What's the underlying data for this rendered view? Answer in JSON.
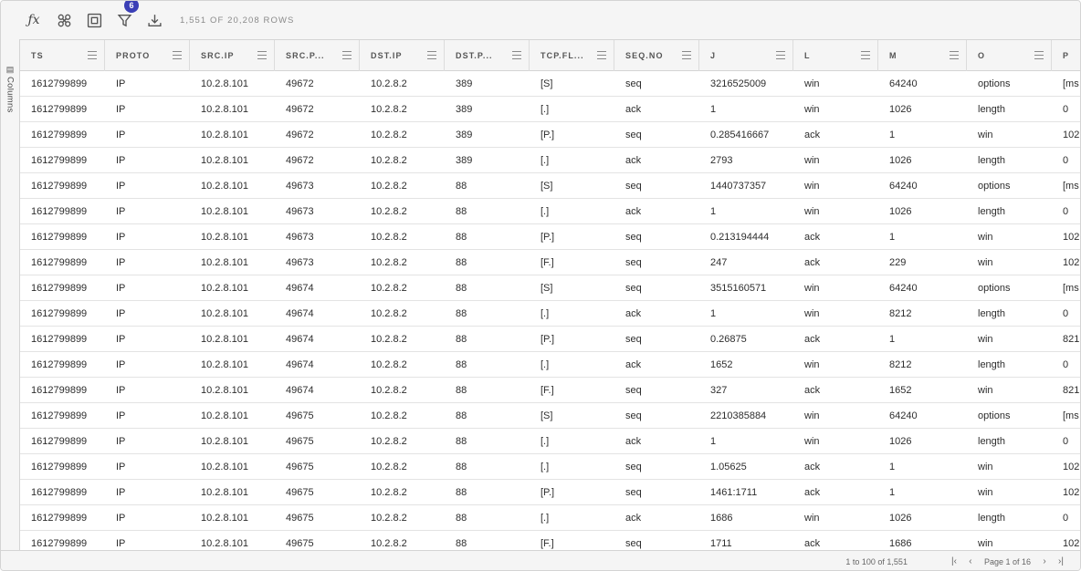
{
  "toolbar": {
    "row_count": "1,551 of 20,208 rows",
    "filter_badge": "6"
  },
  "side_panel": {
    "label": "Columns"
  },
  "columns": [
    "TS",
    "PROTO",
    "SRC.IP",
    "SRC.P...",
    "DST.IP",
    "DST.P...",
    "TCP.FL...",
    "SEQ.NO",
    "J",
    "L",
    "M",
    "O",
    "P"
  ],
  "rows": [
    [
      "1612799899",
      "IP",
      "10.2.8.101",
      "49672",
      "10.2.8.2",
      "389",
      "[S]",
      "seq",
      "3216525009",
      "win",
      "64240",
      "options",
      "[ms"
    ],
    [
      "1612799899",
      "IP",
      "10.2.8.101",
      "49672",
      "10.2.8.2",
      "389",
      "[.]",
      "ack",
      "1",
      "win",
      "1026",
      "length",
      "0"
    ],
    [
      "1612799899",
      "IP",
      "10.2.8.101",
      "49672",
      "10.2.8.2",
      "389",
      "[P.]",
      "seq",
      "0.285416667",
      "ack",
      "1",
      "win",
      "102"
    ],
    [
      "1612799899",
      "IP",
      "10.2.8.101",
      "49672",
      "10.2.8.2",
      "389",
      "[.]",
      "ack",
      "2793",
      "win",
      "1026",
      "length",
      "0"
    ],
    [
      "1612799899",
      "IP",
      "10.2.8.101",
      "49673",
      "10.2.8.2",
      "88",
      "[S]",
      "seq",
      "1440737357",
      "win",
      "64240",
      "options",
      "[ms"
    ],
    [
      "1612799899",
      "IP",
      "10.2.8.101",
      "49673",
      "10.2.8.2",
      "88",
      "[.]",
      "ack",
      "1",
      "win",
      "1026",
      "length",
      "0"
    ],
    [
      "1612799899",
      "IP",
      "10.2.8.101",
      "49673",
      "10.2.8.2",
      "88",
      "[P.]",
      "seq",
      "0.213194444",
      "ack",
      "1",
      "win",
      "102"
    ],
    [
      "1612799899",
      "IP",
      "10.2.8.101",
      "49673",
      "10.2.8.2",
      "88",
      "[F.]",
      "seq",
      "247",
      "ack",
      "229",
      "win",
      "102"
    ],
    [
      "1612799899",
      "IP",
      "10.2.8.101",
      "49674",
      "10.2.8.2",
      "88",
      "[S]",
      "seq",
      "3515160571",
      "win",
      "64240",
      "options",
      "[ms"
    ],
    [
      "1612799899",
      "IP",
      "10.2.8.101",
      "49674",
      "10.2.8.2",
      "88",
      "[.]",
      "ack",
      "1",
      "win",
      "8212",
      "length",
      "0"
    ],
    [
      "1612799899",
      "IP",
      "10.2.8.101",
      "49674",
      "10.2.8.2",
      "88",
      "[P.]",
      "seq",
      "0.26875",
      "ack",
      "1",
      "win",
      "821"
    ],
    [
      "1612799899",
      "IP",
      "10.2.8.101",
      "49674",
      "10.2.8.2",
      "88",
      "[.]",
      "ack",
      "1652",
      "win",
      "8212",
      "length",
      "0"
    ],
    [
      "1612799899",
      "IP",
      "10.2.8.101",
      "49674",
      "10.2.8.2",
      "88",
      "[F.]",
      "seq",
      "327",
      "ack",
      "1652",
      "win",
      "821"
    ],
    [
      "1612799899",
      "IP",
      "10.2.8.101",
      "49675",
      "10.2.8.2",
      "88",
      "[S]",
      "seq",
      "2210385884",
      "win",
      "64240",
      "options",
      "[ms"
    ],
    [
      "1612799899",
      "IP",
      "10.2.8.101",
      "49675",
      "10.2.8.2",
      "88",
      "[.]",
      "ack",
      "1",
      "win",
      "1026",
      "length",
      "0"
    ],
    [
      "1612799899",
      "IP",
      "10.2.8.101",
      "49675",
      "10.2.8.2",
      "88",
      "[.]",
      "seq",
      "1.05625",
      "ack",
      "1",
      "win",
      "102"
    ],
    [
      "1612799899",
      "IP",
      "10.2.8.101",
      "49675",
      "10.2.8.2",
      "88",
      "[P.]",
      "seq",
      "1461:1711",
      "ack",
      "1",
      "win",
      "102"
    ],
    [
      "1612799899",
      "IP",
      "10.2.8.101",
      "49675",
      "10.2.8.2",
      "88",
      "[.]",
      "ack",
      "1686",
      "win",
      "1026",
      "length",
      "0"
    ],
    [
      "1612799899",
      "IP",
      "10.2.8.101",
      "49675",
      "10.2.8.2",
      "88",
      "[F.]",
      "seq",
      "1711",
      "ack",
      "1686",
      "win",
      "102"
    ]
  ],
  "footer": {
    "range": "1 to 100 of 1,551",
    "page": "Page 1 of 16"
  },
  "colors": {
    "accent": "#3b3fb6"
  }
}
